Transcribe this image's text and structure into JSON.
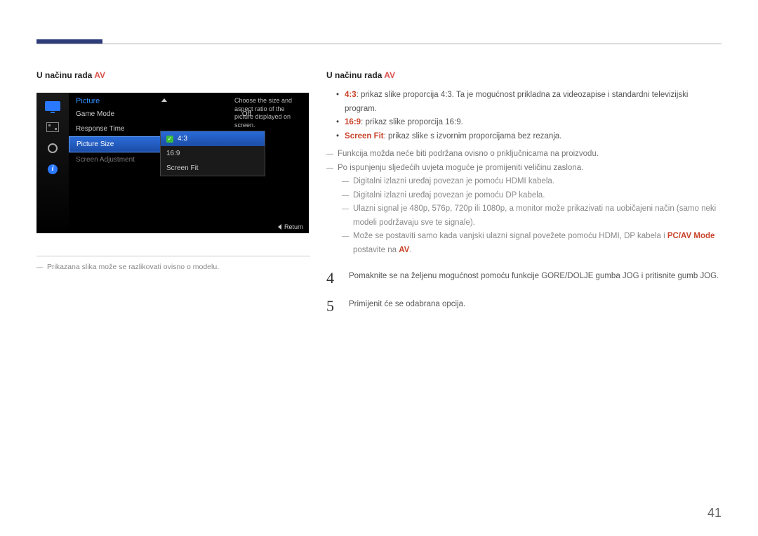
{
  "left": {
    "heading": "U načinu rada ",
    "heading_red": "AV",
    "osd": {
      "title": "Picture",
      "rows": {
        "game_mode": {
          "label": "Game Mode",
          "value": "Off"
        },
        "response_time": {
          "label": "Response Time"
        },
        "picture_size": {
          "label": "Picture Size"
        },
        "screen_adjustment": {
          "label": "Screen Adjustment"
        }
      },
      "hint": "Choose the size and aspect ratio of the picture displayed on screen.",
      "submenu": {
        "opt1": "4:3",
        "opt2": "16:9",
        "opt3": "Screen Fit"
      },
      "return": "Return",
      "info_i": "i"
    },
    "note": "Prikazana slika može se razlikovati ovisno o modelu."
  },
  "right": {
    "heading": "U načinu rada ",
    "heading_red": "AV",
    "b1_bold": "4:3",
    "b1_text": ": prikaz slike proporcija 4:3. Ta je mogućnost prikladna za videozapise i standardni televizijski program.",
    "b2_bold": "16:9",
    "b2_text": ": prikaz slike proporcija 16:9.",
    "b3_bold": "Screen Fit",
    "b3_text": ": prikaz slike s izvornim proporcijama bez rezanja.",
    "d1": "Funkcija možda neće biti podržana ovisno o priključnicama na proizvodu.",
    "d2": "Po ispunjenju sljedećih uvjeta moguće je promijeniti veličinu zaslona.",
    "s1": "Digitalni izlazni uređaj povezan je pomoću HDMI kabela.",
    "s2": "Digitalni izlazni uređaj povezan je pomoću DP kabela.",
    "s3": "Ulazni signal je 480p, 576p, 720p ili 1080p, a monitor može prikazivati na uobičajeni način (samo neki modeli podržavaju sve te signale).",
    "s4_pre": "Može se postaviti samo kada vanjski ulazni signal povežete pomoću HDMI, DP kabela i ",
    "s4_bold1": "PC/AV Mode",
    "s4_mid": " postavite na ",
    "s4_bold2": "AV",
    "s4_post": ".",
    "step4_num": "4",
    "step4": "Pomaknite se na željenu mogućnost pomoću funkcije GORE/DOLJE gumba JOG i pritisnite gumb JOG.",
    "step5_num": "5",
    "step5": "Primijenit će se odabrana opcija."
  },
  "page_number": "41"
}
